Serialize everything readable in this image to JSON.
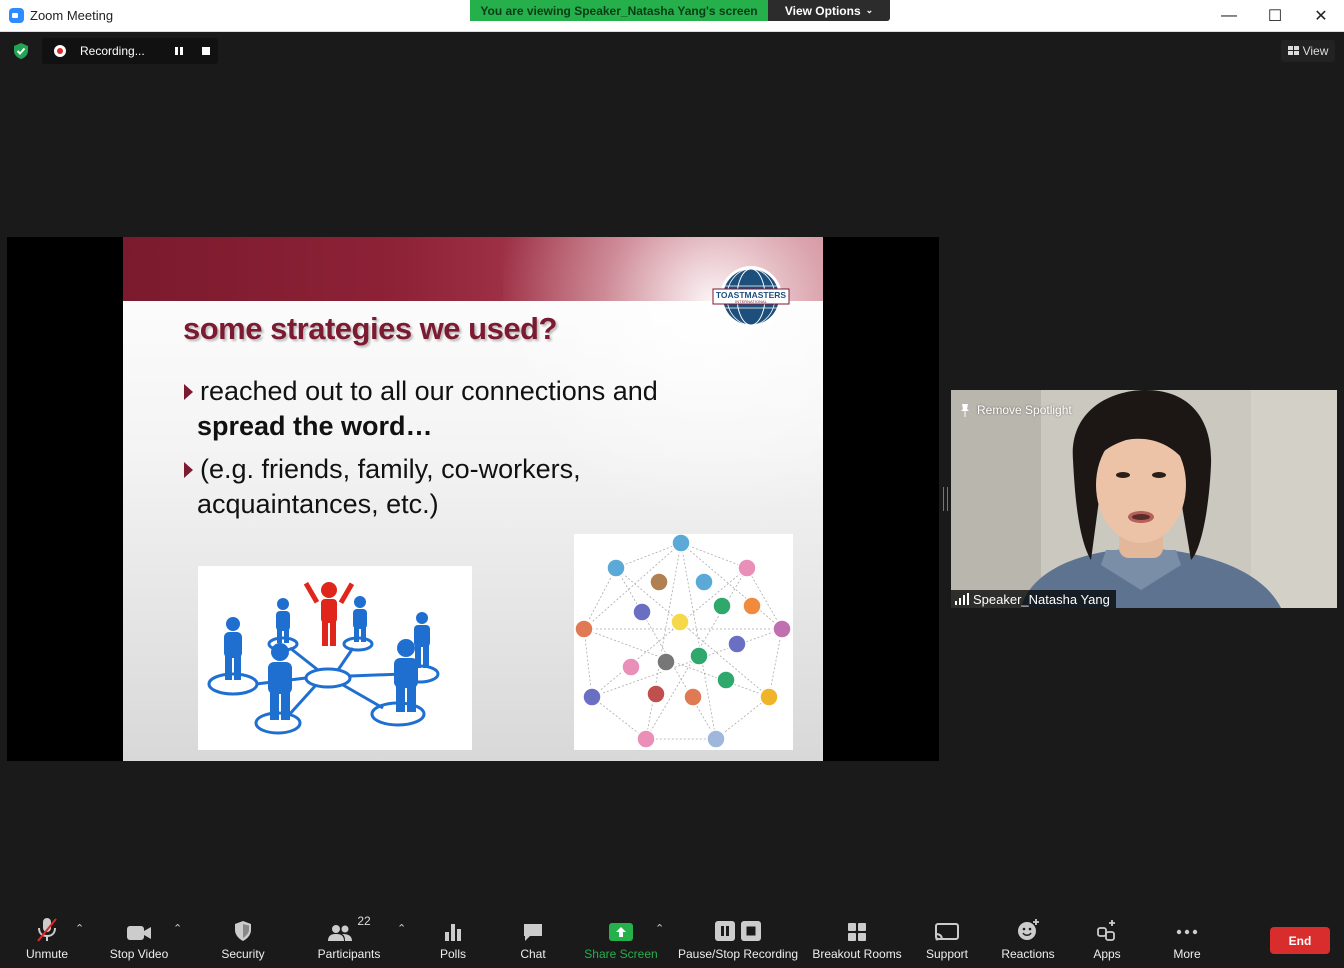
{
  "window": {
    "title": "Zoom Meeting",
    "minimize": "—",
    "maximize": "☐",
    "close": "✕"
  },
  "banner": {
    "viewing_text": "You are viewing Speaker_Natasha Yang's screen",
    "view_options": "View Options"
  },
  "recording": {
    "status": "Recording..."
  },
  "view_button": "View",
  "slide": {
    "title": "some strategies we used?",
    "bullet1_line1": "reached out to all our connections and",
    "bullet1_line2": "spread the word…",
    "bullet2_line1": "(e.g. friends, family, co-workers,",
    "bullet2_line2": "acquaintances, etc.)",
    "logo_text": "TOASTMASTERS",
    "logo_subtext": "INTERNATIONAL"
  },
  "video": {
    "remove_spotlight": "Remove Spotlight",
    "participant_name": "Speaker_Natasha Yang"
  },
  "toolbar": {
    "unmute": "Unmute",
    "stop_video": "Stop Video",
    "security": "Security",
    "participants": "Participants",
    "participants_count": "22",
    "polls": "Polls",
    "chat": "Chat",
    "share_screen": "Share Screen",
    "pause_stop_recording": "Pause/Stop Recording",
    "breakout_rooms": "Breakout Rooms",
    "support": "Support",
    "reactions": "Reactions",
    "apps": "Apps",
    "more": "More",
    "end": "End"
  },
  "colors": {
    "share_green": "#25b04b",
    "slide_maroon": "#7c1a32",
    "end_red": "#d92d2d",
    "people_blue": "#1f6fd1",
    "people_red": "#e0251b"
  }
}
